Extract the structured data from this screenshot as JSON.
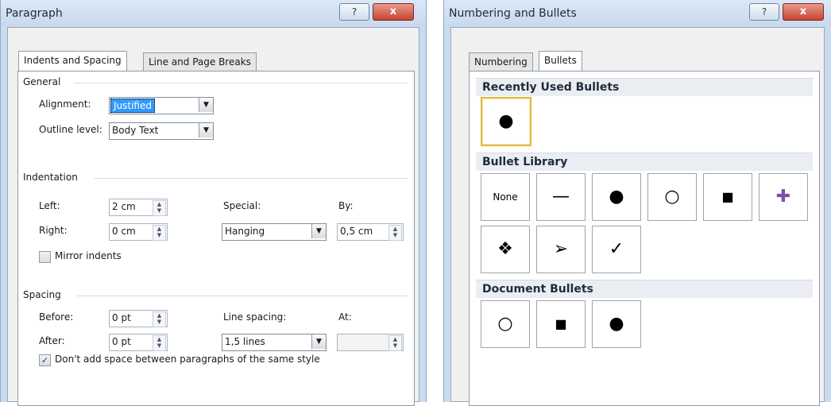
{
  "paragraph": {
    "title": "Paragraph",
    "help": "?",
    "close": "x",
    "tabs": [
      "Indents and Spacing",
      "Line and Page Breaks"
    ],
    "general": {
      "label": "General",
      "alignment_label": "Alignment:",
      "alignment_value": "Justified",
      "outline_label": "Outline level:",
      "outline_value": "Body Text"
    },
    "indentation": {
      "label": "Indentation",
      "left_label": "Left:",
      "left_value": "2 cm",
      "right_label": "Right:",
      "right_value": "0 cm",
      "special_label": "Special:",
      "special_value": "Hanging",
      "by_label": "By:",
      "by_value": "0,5 cm",
      "mirror_label": "Mirror indents"
    },
    "spacing": {
      "label": "Spacing",
      "before_label": "Before:",
      "before_value": "0 pt",
      "after_label": "After:",
      "after_value": "0 pt",
      "line_spacing_label": "Line spacing:",
      "line_spacing_value": "1,5 lines",
      "at_label": "At:",
      "at_value": "",
      "dont_add_label": "Don't add space between paragraphs of the same style",
      "check_mark": "✓"
    }
  },
  "bullets_dialog": {
    "title": "Numbering and Bullets",
    "help": "?",
    "close": "x",
    "tabs": [
      "Numbering",
      "Bullets"
    ],
    "recent": {
      "label": "Recently Used Bullets",
      "items": [
        "●"
      ]
    },
    "library": {
      "label": "Bullet Library",
      "items": [
        "None",
        "—",
        "●",
        "○",
        "■",
        "✚",
        "❖",
        "➢",
        "✓"
      ]
    },
    "document": {
      "label": "Document Bullets",
      "items": [
        "○",
        "■",
        "●"
      ]
    }
  },
  "icons": [
    "help-icon",
    "close-icon",
    "dropdown-arrow-icon",
    "spin-arrows-icon",
    "checkbox-icon"
  ]
}
